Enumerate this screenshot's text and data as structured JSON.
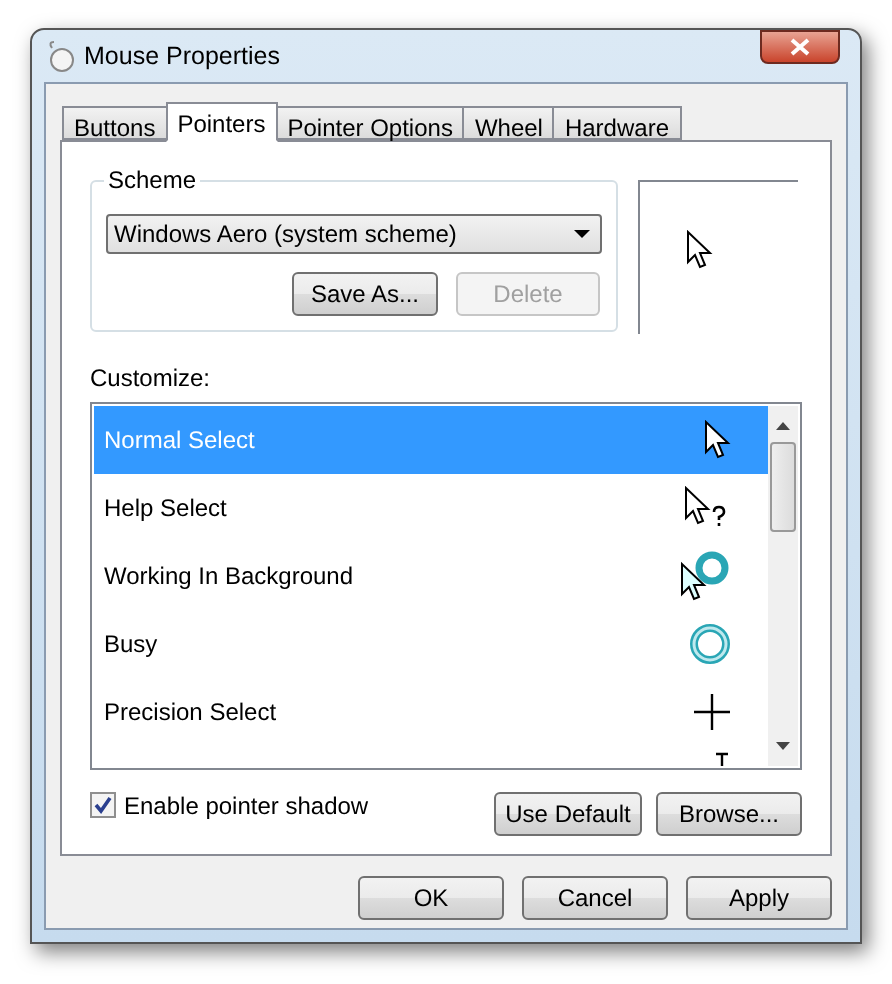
{
  "window": {
    "title": "Mouse Properties"
  },
  "tabs": [
    {
      "label": "Buttons",
      "selected": false
    },
    {
      "label": "Pointers",
      "selected": true
    },
    {
      "label": "Pointer Options",
      "selected": false
    },
    {
      "label": "Wheel",
      "selected": false
    },
    {
      "label": "Hardware",
      "selected": false
    }
  ],
  "scheme": {
    "label": "Scheme",
    "value": "Windows Aero (system scheme)",
    "save_as": "Save As...",
    "delete": {
      "label": "Delete",
      "disabled": true
    }
  },
  "customize": {
    "label": "Customize:",
    "items": [
      {
        "label": "Normal Select",
        "kind": "arrow",
        "selected": true
      },
      {
        "label": "Help Select",
        "kind": "help",
        "selected": false
      },
      {
        "label": "Working In Background",
        "kind": "working",
        "selected": false
      },
      {
        "label": "Busy",
        "kind": "busy",
        "selected": false
      },
      {
        "label": "Precision Select",
        "kind": "cross",
        "selected": false
      },
      {
        "kind": "text",
        "selected": false
      }
    ]
  },
  "shadow": {
    "label": "Enable pointer shadow",
    "checked": true
  },
  "use_default": "Use Default",
  "browse": "Browse...",
  "buttons": [
    "OK",
    "Cancel",
    "Apply"
  ]
}
